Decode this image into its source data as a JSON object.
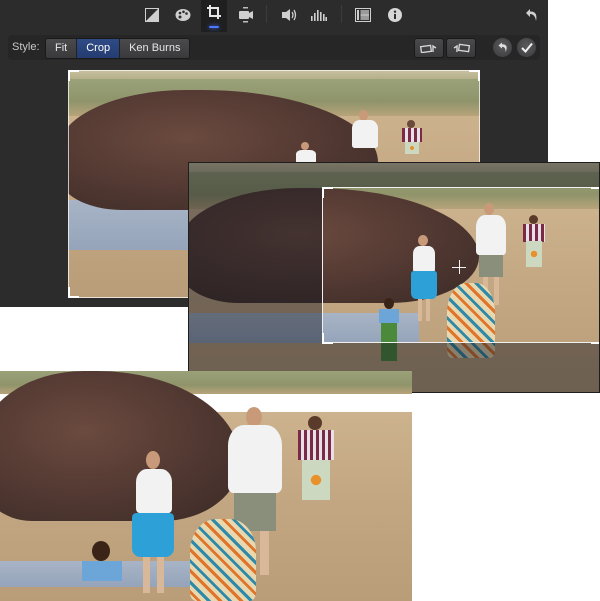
{
  "toolbar": {
    "icons": [
      {
        "name": "color-balance-icon",
        "label": "Color Balance"
      },
      {
        "name": "color-correction-icon",
        "label": "Color Correction"
      },
      {
        "name": "crop-icon",
        "label": "Crop",
        "active": true
      },
      {
        "name": "stabilization-icon",
        "label": "Stabilization"
      },
      {
        "name": "volume-icon",
        "label": "Volume"
      },
      {
        "name": "equalizer-icon",
        "label": "Noise Reduction and Equalizer"
      },
      {
        "name": "clip-filter-icon",
        "label": "Clip Filter"
      },
      {
        "name": "info-icon",
        "label": "Clip Information"
      }
    ],
    "reset_all_label": "Reset"
  },
  "style_bar": {
    "label": "Style:",
    "options": [
      "Fit",
      "Crop",
      "Ken Burns"
    ],
    "selected": "Crop",
    "rotate_left_label": "Rotate left",
    "rotate_right_label": "Rotate right",
    "reset_label": "Reset",
    "apply_label": "Apply"
  },
  "accent_color": "#4a78ff",
  "selected_segment_color": "#2f4b86",
  "views": [
    {
      "name": "viewer-fit-frame",
      "description": "Crop frame in viewer"
    },
    {
      "name": "viewer-crop-adjust",
      "description": "Adjusting crop rectangle"
    },
    {
      "name": "cropped-result",
      "description": "Resulting cropped image"
    }
  ]
}
